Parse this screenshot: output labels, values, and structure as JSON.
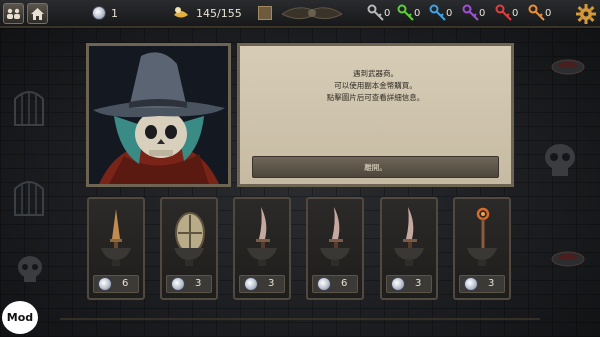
{
  "topbar": {
    "silver_count": "1",
    "food": "145/155",
    "keys": [
      {
        "icon": "gray-key-icon",
        "color": "#b9b9b9",
        "count": "0"
      },
      {
        "icon": "green-key-icon",
        "color": "#5fcf3b",
        "count": "0"
      },
      {
        "icon": "blue-key-icon",
        "color": "#41a3e0",
        "count": "0"
      },
      {
        "icon": "purple-key-icon",
        "color": "#a44fd8",
        "count": "0"
      },
      {
        "icon": "red-key-icon",
        "color": "#e04040",
        "count": "0"
      },
      {
        "icon": "orange-key-icon",
        "color": "#f09030",
        "count": "0"
      }
    ]
  },
  "dialog": {
    "line1": "遇到武器商。",
    "line2": "可以使用副本金幣購買。",
    "line3": "點擊圖片后可查看詳細信息。",
    "leave_label": "離開。"
  },
  "shop": [
    {
      "item": "bronze-dagger",
      "price": "6"
    },
    {
      "item": "round-shield",
      "price": "3"
    },
    {
      "item": "curved-dagger",
      "price": "3"
    },
    {
      "item": "curved-dagger",
      "price": "6"
    },
    {
      "item": "curved-dagger",
      "price": "3"
    },
    {
      "item": "magic-staff",
      "price": "3"
    }
  ],
  "badge": "Mod"
}
